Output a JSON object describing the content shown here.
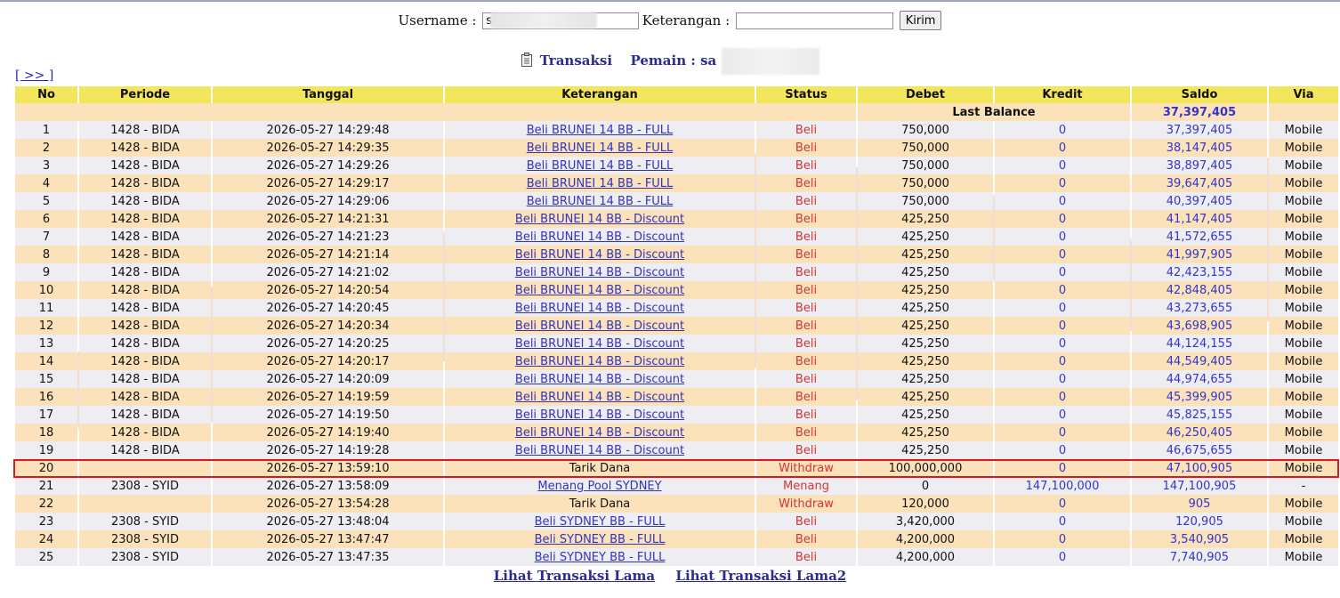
{
  "form": {
    "username_label": "Username :",
    "username_value": "s",
    "keterangan_label": "Keterangan :",
    "keterangan_value": "",
    "submit_label": "Kirim"
  },
  "heading": {
    "title": "Transaksi",
    "player_label": "Pemain : sa"
  },
  "nav": {
    "next": "[ >> ]"
  },
  "table": {
    "headers": [
      "No",
      "Periode",
      "Tanggal",
      "Keterangan",
      "Status",
      "Debet",
      "Kredit",
      "Saldo",
      "Via"
    ],
    "last_balance_label": "Last Balance",
    "last_balance_value": "37,397,405",
    "rows": [
      {
        "no": "1",
        "periode": "1428 - BIDA",
        "tanggal": "2026-05-27 14:29:48",
        "ket": "Beli BRUNEI 14 BB - FULL",
        "link": true,
        "status": "Beli",
        "debet": "750,000",
        "kredit": "0",
        "saldo": "37,397,405",
        "via": "Mobile"
      },
      {
        "no": "2",
        "periode": "1428 - BIDA",
        "tanggal": "2026-05-27 14:29:35",
        "ket": "Beli BRUNEI 14 BB - FULL",
        "link": true,
        "status": "Beli",
        "debet": "750,000",
        "kredit": "0",
        "saldo": "38,147,405",
        "via": "Mobile"
      },
      {
        "no": "3",
        "periode": "1428 - BIDA",
        "tanggal": "2026-05-27 14:29:26",
        "ket": "Beli BRUNEI 14 BB - FULL",
        "link": true,
        "status": "Beli",
        "debet": "750,000",
        "kredit": "0",
        "saldo": "38,897,405",
        "via": "Mobile"
      },
      {
        "no": "4",
        "periode": "1428 - BIDA",
        "tanggal": "2026-05-27 14:29:17",
        "ket": "Beli BRUNEI 14 BB - FULL",
        "link": true,
        "status": "Beli",
        "debet": "750,000",
        "kredit": "0",
        "saldo": "39,647,405",
        "via": "Mobile"
      },
      {
        "no": "5",
        "periode": "1428 - BIDA",
        "tanggal": "2026-05-27 14:29:06",
        "ket": "Beli BRUNEI 14 BB - FULL",
        "link": true,
        "status": "Beli",
        "debet": "750,000",
        "kredit": "0",
        "saldo": "40,397,405",
        "via": "Mobile"
      },
      {
        "no": "6",
        "periode": "1428 - BIDA",
        "tanggal": "2026-05-27 14:21:31",
        "ket": "Beli BRUNEI 14 BB - Discount",
        "link": true,
        "status": "Beli",
        "debet": "425,250",
        "kredit": "0",
        "saldo": "41,147,405",
        "via": "Mobile"
      },
      {
        "no": "7",
        "periode": "1428 - BIDA",
        "tanggal": "2026-05-27 14:21:23",
        "ket": "Beli BRUNEI 14 BB - Discount",
        "link": true,
        "status": "Beli",
        "debet": "425,250",
        "kredit": "0",
        "saldo": "41,572,655",
        "via": "Mobile"
      },
      {
        "no": "8",
        "periode": "1428 - BIDA",
        "tanggal": "2026-05-27 14:21:14",
        "ket": "Beli BRUNEI 14 BB - Discount",
        "link": true,
        "status": "Beli",
        "debet": "425,250",
        "kredit": "0",
        "saldo": "41,997,905",
        "via": "Mobile"
      },
      {
        "no": "9",
        "periode": "1428 - BIDA",
        "tanggal": "2026-05-27 14:21:02",
        "ket": "Beli BRUNEI 14 BB - Discount",
        "link": true,
        "status": "Beli",
        "debet": "425,250",
        "kredit": "0",
        "saldo": "42,423,155",
        "via": "Mobile"
      },
      {
        "no": "10",
        "periode": "1428 - BIDA",
        "tanggal": "2026-05-27 14:20:54",
        "ket": "Beli BRUNEI 14 BB - Discount",
        "link": true,
        "status": "Beli",
        "debet": "425,250",
        "kredit": "0",
        "saldo": "42,848,405",
        "via": "Mobile"
      },
      {
        "no": "11",
        "periode": "1428 - BIDA",
        "tanggal": "2026-05-27 14:20:45",
        "ket": "Beli BRUNEI 14 BB - Discount",
        "link": true,
        "status": "Beli",
        "debet": "425,250",
        "kredit": "0",
        "saldo": "43,273,655",
        "via": "Mobile"
      },
      {
        "no": "12",
        "periode": "1428 - BIDA",
        "tanggal": "2026-05-27 14:20:34",
        "ket": "Beli BRUNEI 14 BB - Discount",
        "link": true,
        "status": "Beli",
        "debet": "425,250",
        "kredit": "0",
        "saldo": "43,698,905",
        "via": "Mobile"
      },
      {
        "no": "13",
        "periode": "1428 - BIDA",
        "tanggal": "2026-05-27 14:20:25",
        "ket": "Beli BRUNEI 14 BB - Discount",
        "link": true,
        "status": "Beli",
        "debet": "425,250",
        "kredit": "0",
        "saldo": "44,124,155",
        "via": "Mobile"
      },
      {
        "no": "14",
        "periode": "1428 - BIDA",
        "tanggal": "2026-05-27 14:20:17",
        "ket": "Beli BRUNEI 14 BB - Discount",
        "link": true,
        "status": "Beli",
        "debet": "425,250",
        "kredit": "0",
        "saldo": "44,549,405",
        "via": "Mobile"
      },
      {
        "no": "15",
        "periode": "1428 - BIDA",
        "tanggal": "2026-05-27 14:20:09",
        "ket": "Beli BRUNEI 14 BB - Discount",
        "link": true,
        "status": "Beli",
        "debet": "425,250",
        "kredit": "0",
        "saldo": "44,974,655",
        "via": "Mobile"
      },
      {
        "no": "16",
        "periode": "1428 - BIDA",
        "tanggal": "2026-05-27 14:19:59",
        "ket": "Beli BRUNEI 14 BB - Discount",
        "link": true,
        "status": "Beli",
        "debet": "425,250",
        "kredit": "0",
        "saldo": "45,399,905",
        "via": "Mobile"
      },
      {
        "no": "17",
        "periode": "1428 - BIDA",
        "tanggal": "2026-05-27 14:19:50",
        "ket": "Beli BRUNEI 14 BB - Discount",
        "link": true,
        "status": "Beli",
        "debet": "425,250",
        "kredit": "0",
        "saldo": "45,825,155",
        "via": "Mobile"
      },
      {
        "no": "18",
        "periode": "1428 - BIDA",
        "tanggal": "2026-05-27 14:19:40",
        "ket": "Beli BRUNEI 14 BB - Discount",
        "link": true,
        "status": "Beli",
        "debet": "425,250",
        "kredit": "0",
        "saldo": "46,250,405",
        "via": "Mobile"
      },
      {
        "no": "19",
        "periode": "1428 - BIDA",
        "tanggal": "2026-05-27 14:19:28",
        "ket": "Beli BRUNEI 14 BB - Discount",
        "link": true,
        "status": "Beli",
        "debet": "425,250",
        "kredit": "0",
        "saldo": "46,675,655",
        "via": "Mobile"
      },
      {
        "no": "20",
        "periode": "",
        "tanggal": "2026-05-27 13:59:10",
        "ket": "Tarik Dana",
        "link": false,
        "status": "Withdraw",
        "debet": "100,000,000",
        "kredit": "0",
        "saldo": "47,100,905",
        "via": "Mobile",
        "highlight": true
      },
      {
        "no": "21",
        "periode": "2308 - SYID",
        "tanggal": "2026-05-27 13:58:09",
        "ket": "Menang Pool SYDNEY",
        "link": true,
        "status": "Menang",
        "debet": "0",
        "kredit": "147,100,000",
        "saldo": "147,100,905",
        "via": "-"
      },
      {
        "no": "22",
        "periode": "",
        "tanggal": "2026-05-27 13:54:28",
        "ket": "Tarik Dana",
        "link": false,
        "status": "Withdraw",
        "debet": "120,000",
        "kredit": "0",
        "saldo": "905",
        "via": "Mobile"
      },
      {
        "no": "23",
        "periode": "2308 - SYID",
        "tanggal": "2026-05-27 13:48:04",
        "ket": "Beli SYDNEY BB - FULL",
        "link": true,
        "status": "Beli",
        "debet": "3,420,000",
        "kredit": "0",
        "saldo": "120,905",
        "via": "Mobile"
      },
      {
        "no": "24",
        "periode": "2308 - SYID",
        "tanggal": "2026-05-27 13:47:47",
        "ket": "Beli SYDNEY BB - FULL",
        "link": true,
        "status": "Beli",
        "debet": "4,200,000",
        "kredit": "0",
        "saldo": "3,540,905",
        "via": "Mobile"
      },
      {
        "no": "25",
        "periode": "2308 - SYID",
        "tanggal": "2026-05-27 13:47:35",
        "ket": "Beli SYDNEY BB - FULL",
        "link": true,
        "status": "Beli",
        "debet": "4,200,000",
        "kredit": "0",
        "saldo": "7,740,905",
        "via": "Mobile"
      }
    ]
  },
  "footer": {
    "link1": "Lihat Transaksi Lama",
    "link2": "Lihat Transaksi Lama2"
  },
  "colors": {
    "header_bg": "#f4e65c",
    "row_odd": "#eeeef2",
    "row_even": "#fbe2bb",
    "link": "#3333bb",
    "status_red": "#d23434",
    "highlight_border": "#e01818"
  }
}
